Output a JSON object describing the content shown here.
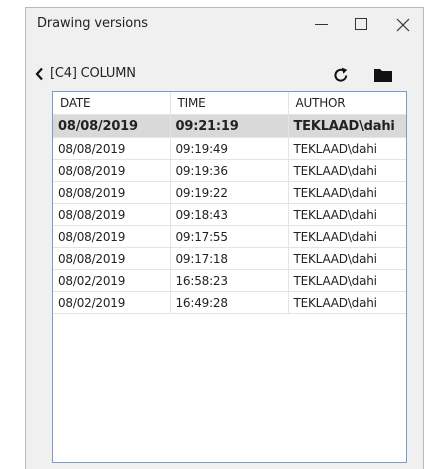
{
  "window": {
    "title": "Drawing versions"
  },
  "toolbar": {
    "breadcrumb": "[C4] COLUMN"
  },
  "table": {
    "columns": [
      "DATE",
      "TIME",
      "AUTHOR"
    ],
    "rows": [
      {
        "date": "08/08/2019",
        "time": "09:21:19",
        "author": "TEKLAAD\\dahi"
      },
      {
        "date": "08/08/2019",
        "time": "09:19:49",
        "author": "TEKLAAD\\dahi"
      },
      {
        "date": "08/08/2019",
        "time": "09:19:36",
        "author": "TEKLAAD\\dahi"
      },
      {
        "date": "08/08/2019",
        "time": "09:19:22",
        "author": "TEKLAAD\\dahi"
      },
      {
        "date": "08/08/2019",
        "time": "09:18:43",
        "author": "TEKLAAD\\dahi"
      },
      {
        "date": "08/08/2019",
        "time": "09:17:55",
        "author": "TEKLAAD\\dahi"
      },
      {
        "date": "08/08/2019",
        "time": "09:17:18",
        "author": "TEKLAAD\\dahi"
      },
      {
        "date": "08/02/2019",
        "time": "16:58:23",
        "author": "TEKLAAD\\dahi"
      },
      {
        "date": "08/02/2019",
        "time": "16:49:28",
        "author": "TEKLAAD\\dahi"
      }
    ],
    "selected_index": 0
  },
  "icons": {
    "minimize": "minimize-icon",
    "maximize": "maximize-icon",
    "close": "close-icon",
    "back": "chevron-left-icon",
    "refresh": "refresh-icon",
    "folder": "folder-icon"
  },
  "colors": {
    "window_bg": "#f0f0f0",
    "grid_border": "#7a9cc6",
    "selected_row": "#d9d9d9"
  }
}
